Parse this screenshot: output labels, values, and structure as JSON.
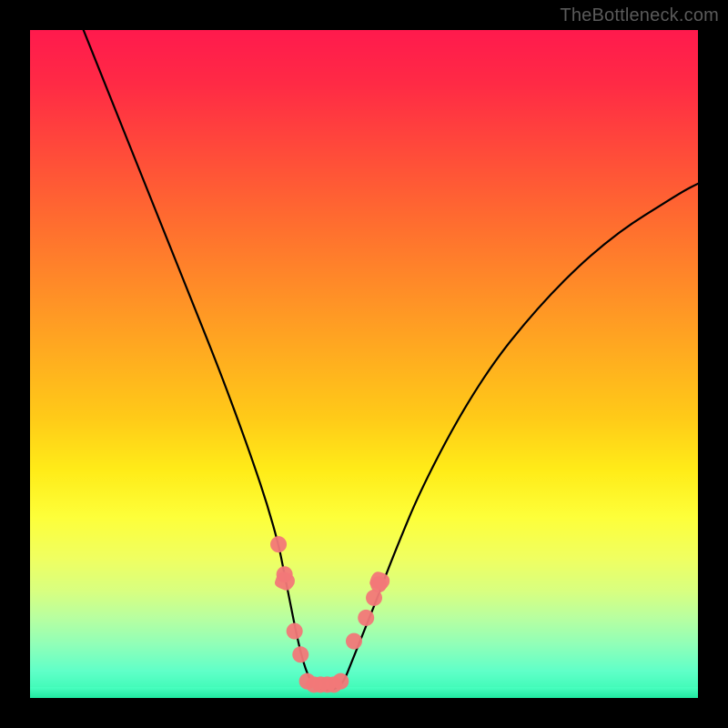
{
  "watermark": "TheBottleneck.com",
  "chart_data": {
    "type": "line",
    "title": "",
    "xlabel": "",
    "ylabel": "",
    "xlim": [
      0,
      100
    ],
    "ylim": [
      0,
      100
    ],
    "curve": {
      "name": "bottleneck-curve",
      "x": [
        8,
        12,
        16,
        20,
        24,
        28,
        31,
        33.5,
        35.5,
        37.2,
        38,
        39,
        40,
        41,
        42,
        43,
        44,
        45,
        46,
        47,
        48,
        50,
        52,
        53.5,
        55.5,
        58,
        62,
        66,
        70,
        74,
        78,
        82,
        86,
        90,
        94,
        98,
        100
      ],
      "y": [
        100,
        90,
        80,
        70,
        60,
        50,
        42,
        35,
        29,
        23,
        19,
        14,
        9,
        5,
        2.5,
        1.5,
        1.2,
        1.2,
        1.5,
        2.5,
        5,
        10,
        15,
        19,
        24,
        30,
        38,
        45,
        51,
        56,
        60.5,
        64.5,
        68,
        71,
        73.5,
        76,
        77
      ]
    },
    "markers": {
      "name": "bottleneck-markers",
      "color": "#f27878",
      "points": [
        {
          "x": 37.2,
          "y": 23
        },
        {
          "x": 38.1,
          "y": 18.5
        },
        {
          "x": 38.2,
          "y": 17.5,
          "type": "splat"
        },
        {
          "x": 39.6,
          "y": 10
        },
        {
          "x": 40.5,
          "y": 6.5
        },
        {
          "x": 41.5,
          "y": 2.5
        },
        {
          "x": 42.5,
          "y": 2.0
        },
        {
          "x": 43.5,
          "y": 2.0
        },
        {
          "x": 44.5,
          "y": 2.0
        },
        {
          "x": 45.5,
          "y": 2.0
        },
        {
          "x": 46.5,
          "y": 2.5
        },
        {
          "x": 48.5,
          "y": 8.5
        },
        {
          "x": 50.3,
          "y": 12
        },
        {
          "x": 51.5,
          "y": 15
        },
        {
          "x": 52.2,
          "y": 17
        },
        {
          "x": 52.4,
          "y": 17.5,
          "type": "splat"
        }
      ]
    },
    "background": {
      "type": "vertical-gradient",
      "stops": [
        {
          "pos": 0,
          "color": "#ff1a4d"
        },
        {
          "pos": 50,
          "color": "#ffaa20"
        },
        {
          "pos": 75,
          "color": "#ffff40"
        },
        {
          "pos": 100,
          "color": "#20e8a0"
        }
      ]
    }
  }
}
